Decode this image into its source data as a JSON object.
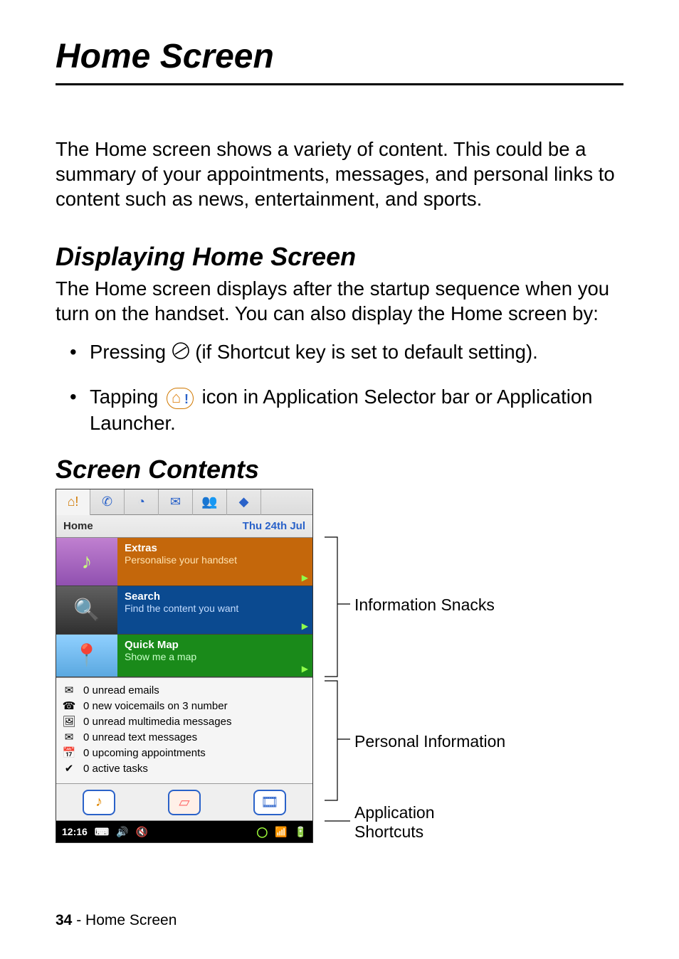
{
  "page": {
    "title": "Home Screen",
    "intro": "The Home screen shows a variety of content. This could be a summary of your appointments, messages, and personal links to content such as news, entertainment, and sports.",
    "section1_heading": "Displaying Home Screen",
    "section1_body": "The Home screen displays after the startup sequence when you turn on the handset. You can also display the Home screen by:",
    "bullet1_a": "Pressing ",
    "bullet1_b": " (if Shortcut key is set to default setting).",
    "bullet2_a": "Tapping ",
    "bullet2_b": " icon in Application Selector bar or Application Launcher.",
    "section2_heading": "Screen Contents",
    "footer_page": "34",
    "footer_sep": " - ",
    "footer_label": "Home Screen"
  },
  "device": {
    "titlebar": {
      "label": "Home",
      "date": "Thu 24th Jul"
    },
    "snacks": [
      {
        "id": "extras",
        "title": "Extras",
        "subtitle": "Personalise your handset"
      },
      {
        "id": "search",
        "title": "Search",
        "subtitle": "Find the content you want"
      },
      {
        "id": "map",
        "title": "Quick Map",
        "subtitle": "Show me a map"
      }
    ],
    "personal": [
      {
        "icon": "email-icon",
        "glyph": "✉",
        "text": "0 unread emails"
      },
      {
        "icon": "voicemail-icon",
        "glyph": "☎",
        "text": "0 new voicemails on 3 number"
      },
      {
        "icon": "mms-icon",
        "glyph": "🖼",
        "text": "0 unread multimedia messages"
      },
      {
        "icon": "sms-icon",
        "glyph": "✉",
        "text": "0 unread text messages"
      },
      {
        "icon": "calendar-icon",
        "glyph": "📅",
        "text": "0 upcoming appointments"
      },
      {
        "icon": "tasks-icon",
        "glyph": "✔",
        "text": "0 active tasks"
      }
    ],
    "status": {
      "time": "12:16"
    }
  },
  "labels": {
    "snacks": "Information Snacks",
    "personal": "Personal Information",
    "shortcuts_l1": "Application",
    "shortcuts_l2": "Shortcuts"
  }
}
